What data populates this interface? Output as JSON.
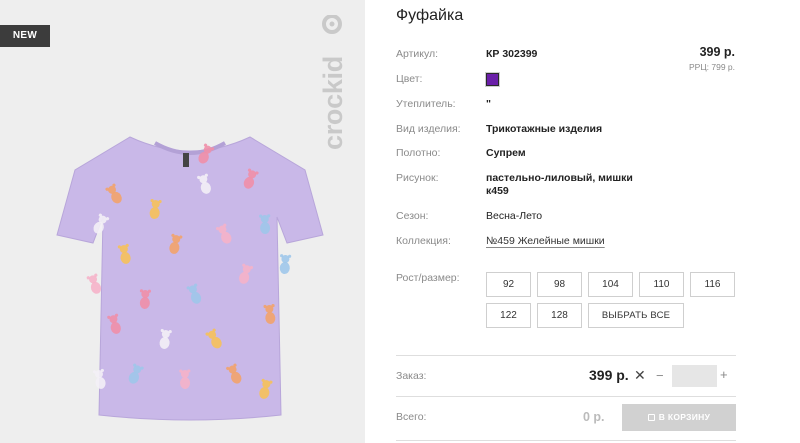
{
  "badge": "NEW",
  "brand": {
    "logo_text": "crockid"
  },
  "product": {
    "title": "Фуфайка",
    "price": "399 р.",
    "rrp": "РРЦ: 799 р."
  },
  "specs": {
    "article_label": "Артикул:",
    "article_value": "КР 302399",
    "color_label": "Цвет:",
    "color_swatch": "#6a1fa8",
    "insulation_label": "Утеплитель:",
    "insulation_value": "\"",
    "kind_label": "Вид изделия:",
    "kind_value": "Трикотажные изделия",
    "fabric_label": "Полотно:",
    "fabric_value": "Супрем",
    "print_label": "Рисунок:",
    "print_value_line1": "пастельно-лиловый, мишки",
    "print_value_line2": "к459",
    "season_label": "Сезон:",
    "season_value": "Весна-Лето",
    "collection_label": "Коллекция:",
    "collection_value": "№459 Желейные мишки"
  },
  "sizes": {
    "label": "Рост/размер:",
    "options": [
      "92",
      "98",
      "104",
      "110",
      "116",
      "122",
      "128"
    ],
    "select_all": "ВЫБРАТЬ ВСЕ"
  },
  "order": {
    "label": "Заказ:",
    "price": "399 р.",
    "times": "✕",
    "minus": "−",
    "plus": "+",
    "qty_value": ""
  },
  "total": {
    "label": "Всего:",
    "value": "0 р.",
    "cart_button": "В КОРЗИНУ"
  },
  "colors": {
    "shirt": "#c8b6e6",
    "accent_purple": "#6a1fa8",
    "badge_bg": "#3c3c3c",
    "cart_disabled": "#d1d1d1"
  }
}
